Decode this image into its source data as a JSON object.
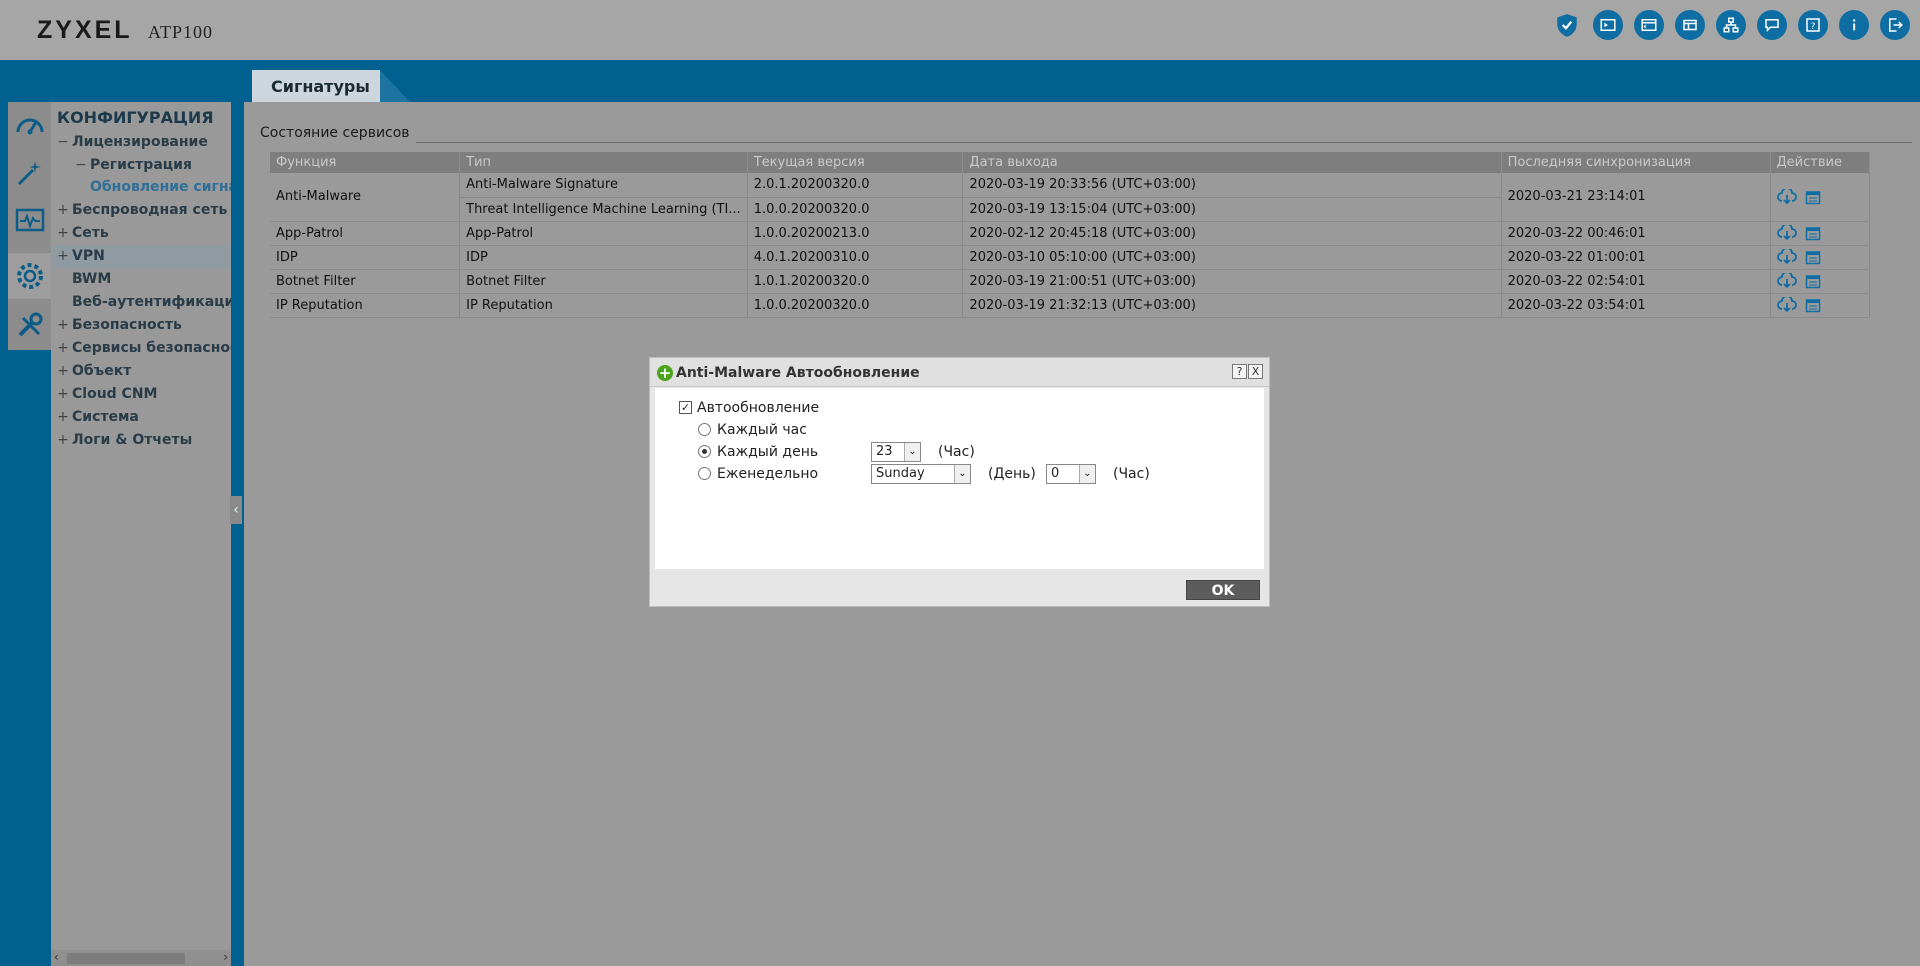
{
  "header": {
    "logo": "ZYXEL",
    "model": "ATP100",
    "icons": [
      "security-shield-icon",
      "console-icon",
      "cli-icon",
      "object-reference-icon",
      "network-map-icon",
      "chat-icon",
      "help-icon",
      "info-icon",
      "logout-icon"
    ]
  },
  "tabs": [
    {
      "label": "Сигнатуры"
    }
  ],
  "nav": {
    "title": "КОНФИГУРАЦИЯ",
    "items": [
      {
        "label": "Лицензирование",
        "sign": "−",
        "level": 0
      },
      {
        "label": "Регистрация",
        "sign": "−",
        "level": 1
      },
      {
        "label": "Обновление сигнатур",
        "sign": "",
        "level": 1
      },
      {
        "label": "Беспроводная сеть",
        "sign": "+",
        "level": 0
      },
      {
        "label": "Сеть",
        "sign": "+",
        "level": 0
      },
      {
        "label": "VPN",
        "sign": "+",
        "level": 0
      },
      {
        "label": "BWM",
        "sign": "",
        "level": 0
      },
      {
        "label": "Веб-аутентификация",
        "sign": "",
        "level": 0
      },
      {
        "label": "Безопасность",
        "sign": "+",
        "level": 0
      },
      {
        "label": "Сервисы безопасности",
        "sign": "+",
        "level": 0
      },
      {
        "label": "Объект",
        "sign": "+",
        "level": 0
      },
      {
        "label": "Cloud CNM",
        "sign": "+",
        "level": 0
      },
      {
        "label": "Система",
        "sign": "+",
        "level": 0
      },
      {
        "label": "Логи & Отчеты",
        "sign": "+",
        "level": 0
      }
    ]
  },
  "section": {
    "title": "Состояние сервисов"
  },
  "table": {
    "headers": [
      "Функция",
      "Тип",
      "Текущая версия",
      "Дата выхода",
      "Последняя синхронизация",
      "Действие"
    ],
    "rows": [
      {
        "func": "Anti-Malware",
        "type": "Anti-Malware Signature",
        "version": "2.0.1.20200320.0",
        "date": "2020-03-19 20:33:56 (UTC+03:00)",
        "sync": "2020-03-21 23:14:01"
      },
      {
        "func": "",
        "type": "Threat Intelligence Machine Learning (TI...",
        "version": "1.0.0.20200320.0",
        "date": "2020-03-19 13:15:04 (UTC+03:00)",
        "sync": ""
      },
      {
        "func": "App-Patrol",
        "type": "App-Patrol",
        "version": "1.0.0.20200213.0",
        "date": "2020-02-12 20:45:18 (UTC+03:00)",
        "sync": "2020-03-22 00:46:01"
      },
      {
        "func": "IDP",
        "type": "IDP",
        "version": "4.0.1.20200310.0",
        "date": "2020-03-10 05:10:00 (UTC+03:00)",
        "sync": "2020-03-22 01:00:01"
      },
      {
        "func": "Botnet Filter",
        "type": "Botnet Filter",
        "version": "1.0.1.20200320.0",
        "date": "2020-03-19 21:00:51 (UTC+03:00)",
        "sync": "2020-03-22 02:54:01"
      },
      {
        "func": "IP Reputation",
        "type": "IP Reputation",
        "version": "1.0.0.20200320.0",
        "date": "2020-03-19 21:32:13 (UTC+03:00)",
        "sync": "2020-03-22 03:54:01"
      }
    ]
  },
  "modal": {
    "title": "Anti-Malware Автообновление",
    "help": "?",
    "close": "X",
    "auto_update_label": "Автообновление",
    "auto_update_checked": true,
    "hourly_label": "Каждый час",
    "daily_label": "Каждый день",
    "weekly_label": "Еженедельно",
    "selected": "daily",
    "daily_hour": "23",
    "weekly_day": "Sunday",
    "weekly_hour": "0",
    "hour_unit": "(Час)",
    "day_unit": "(День)",
    "ok_label": "OK"
  },
  "colors": {
    "accent": "#00608f",
    "icon": "#0e6ea3",
    "ok": "#5c5c5c"
  }
}
